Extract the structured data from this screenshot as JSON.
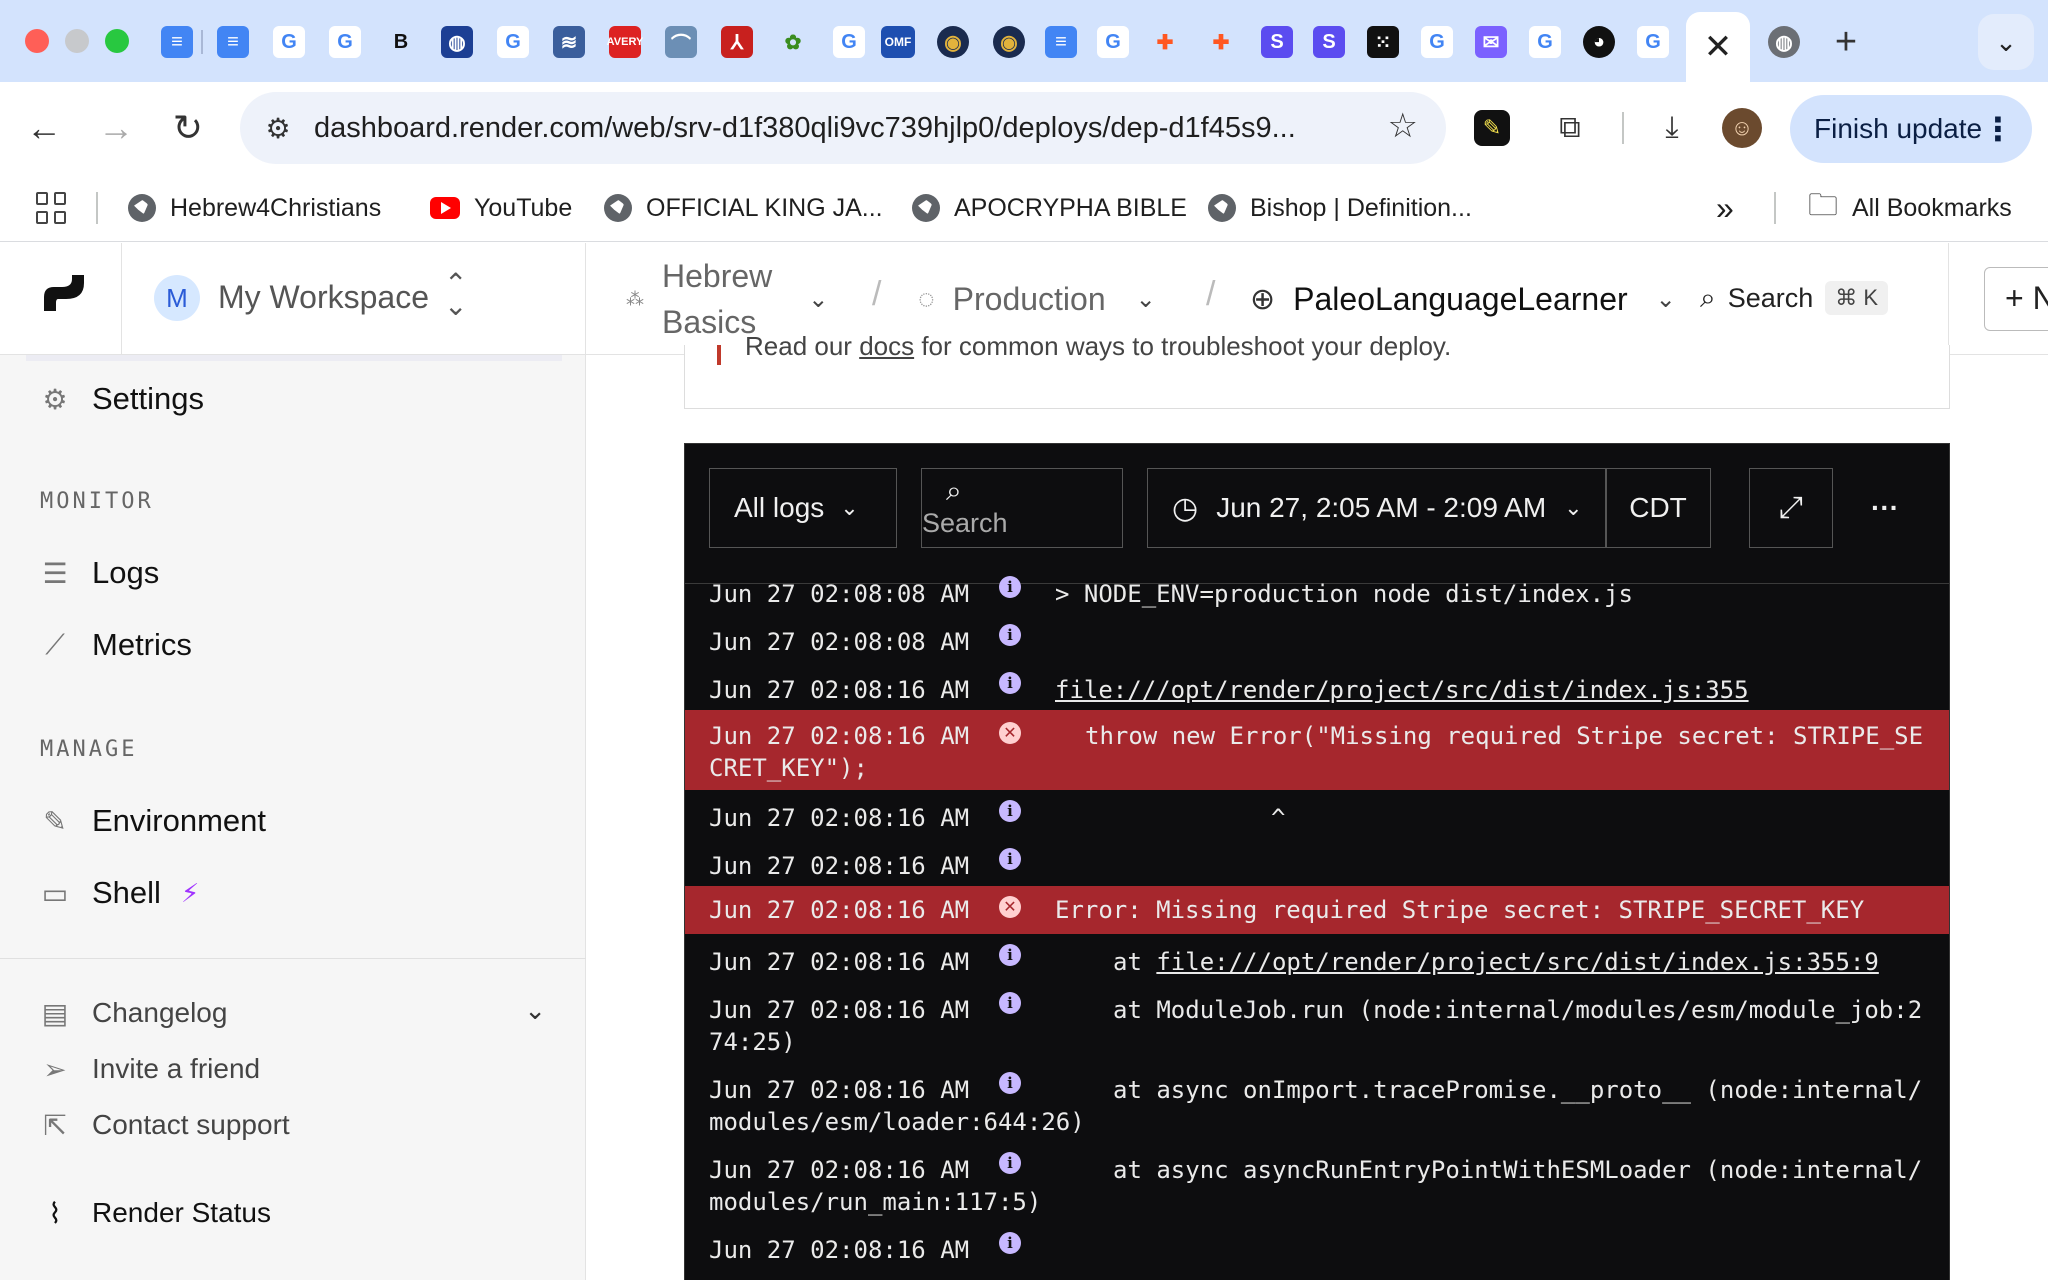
{
  "browser": {
    "active_tab_close": "✕",
    "new_tab": "+",
    "tabs_menu": "⌄",
    "url": "dashboard.render.com/web/srv-d1f380qli9vc739hjlp0/deploys/dep-d1f45s9...",
    "finish_update": "Finish update",
    "bookmarks": [
      "Hebrew4Christians",
      "YouTube",
      "OFFICIAL KING JA...",
      "APOCRYPHA BIBLE",
      "Bishop | Definition..."
    ],
    "all_bookmarks": "All Bookmarks",
    "more_bookmarks": "»"
  },
  "header": {
    "workspace_initial": "M",
    "workspace": "My Workspace",
    "project_line1": "Hebrew",
    "project_line2": "Basics",
    "environment": "Production",
    "service": "PaleoLanguageLearner",
    "search": "Search",
    "shortcut": "⌘ K",
    "new_label": "+ N"
  },
  "sidebar": {
    "settings": "Settings",
    "monitor_heading": "MONITOR",
    "logs": "Logs",
    "metrics": "Metrics",
    "manage_heading": "MANAGE",
    "environment": "Environment",
    "shell": "Shell",
    "changelog": "Changelog",
    "invite": "Invite a friend",
    "support": "Contact support",
    "status": "Render Status"
  },
  "notice": {
    "before": "Read our ",
    "link": "docs",
    "after": " for common ways to troubleshoot your deploy."
  },
  "logs": {
    "filter": "All logs",
    "search_placeholder": "Search",
    "range": "Jun 27, 2:05 AM - 2:09 AM",
    "timezone": "CDT",
    "more": "···",
    "rows": [
      {
        "ts": "Jun 27 02:08:08 AM",
        "level": "info",
        "msg": "> NODE_ENV=production node dist/index.js"
      },
      {
        "ts": "Jun 27 02:08:08 AM",
        "level": "info",
        "msg": ""
      },
      {
        "ts": "Jun 27 02:08:16 AM",
        "level": "info",
        "msg": "file:///opt/render/project/src/dist/index.js:355"
      },
      {
        "ts": "Jun 27 02:08:16 AM",
        "level": "error",
        "msg": "throw new Error(\"Missing required Stripe secret: STRIPE_SE",
        "msg2": "CRET_KEY\");"
      },
      {
        "ts": "Jun 27 02:08:16 AM",
        "level": "info",
        "msg": "^"
      },
      {
        "ts": "Jun 27 02:08:16 AM",
        "level": "info",
        "msg": ""
      },
      {
        "ts": "Jun 27 02:08:16 AM",
        "level": "error",
        "msg": "Error: Missing required Stripe secret: STRIPE_SECRET_KEY"
      },
      {
        "ts": "Jun 27 02:08:16 AM",
        "level": "info",
        "msg_prefix": "at ",
        "msg": "file:///opt/render/project/src/dist/index.js:355:9"
      },
      {
        "ts": "Jun 27 02:08:16 AM",
        "level": "info",
        "msg": "at ModuleJob.run (node:internal/modules/esm/module_job:2",
        "msg2": "74:25)"
      },
      {
        "ts": "Jun 27 02:08:16 AM",
        "level": "info",
        "msg": "at async onImport.tracePromise.__proto__ (node:internal/",
        "msg2": "modules/esm/loader:644:26)"
      },
      {
        "ts": "Jun 27 02:08:16 AM",
        "level": "info",
        "msg": "at async asyncRunEntryPointWithESMLoader (node:internal/",
        "msg2": "modules/run_main:117:5)"
      },
      {
        "ts": "Jun 27 02:08:16 AM",
        "level": "info",
        "msg": ""
      }
    ]
  },
  "colors": {
    "tabstrip": "#d3e3fd",
    "error_row": "#a6272d",
    "log_bg": "#0d0d0f",
    "shell_bolt": "#a033ff"
  }
}
